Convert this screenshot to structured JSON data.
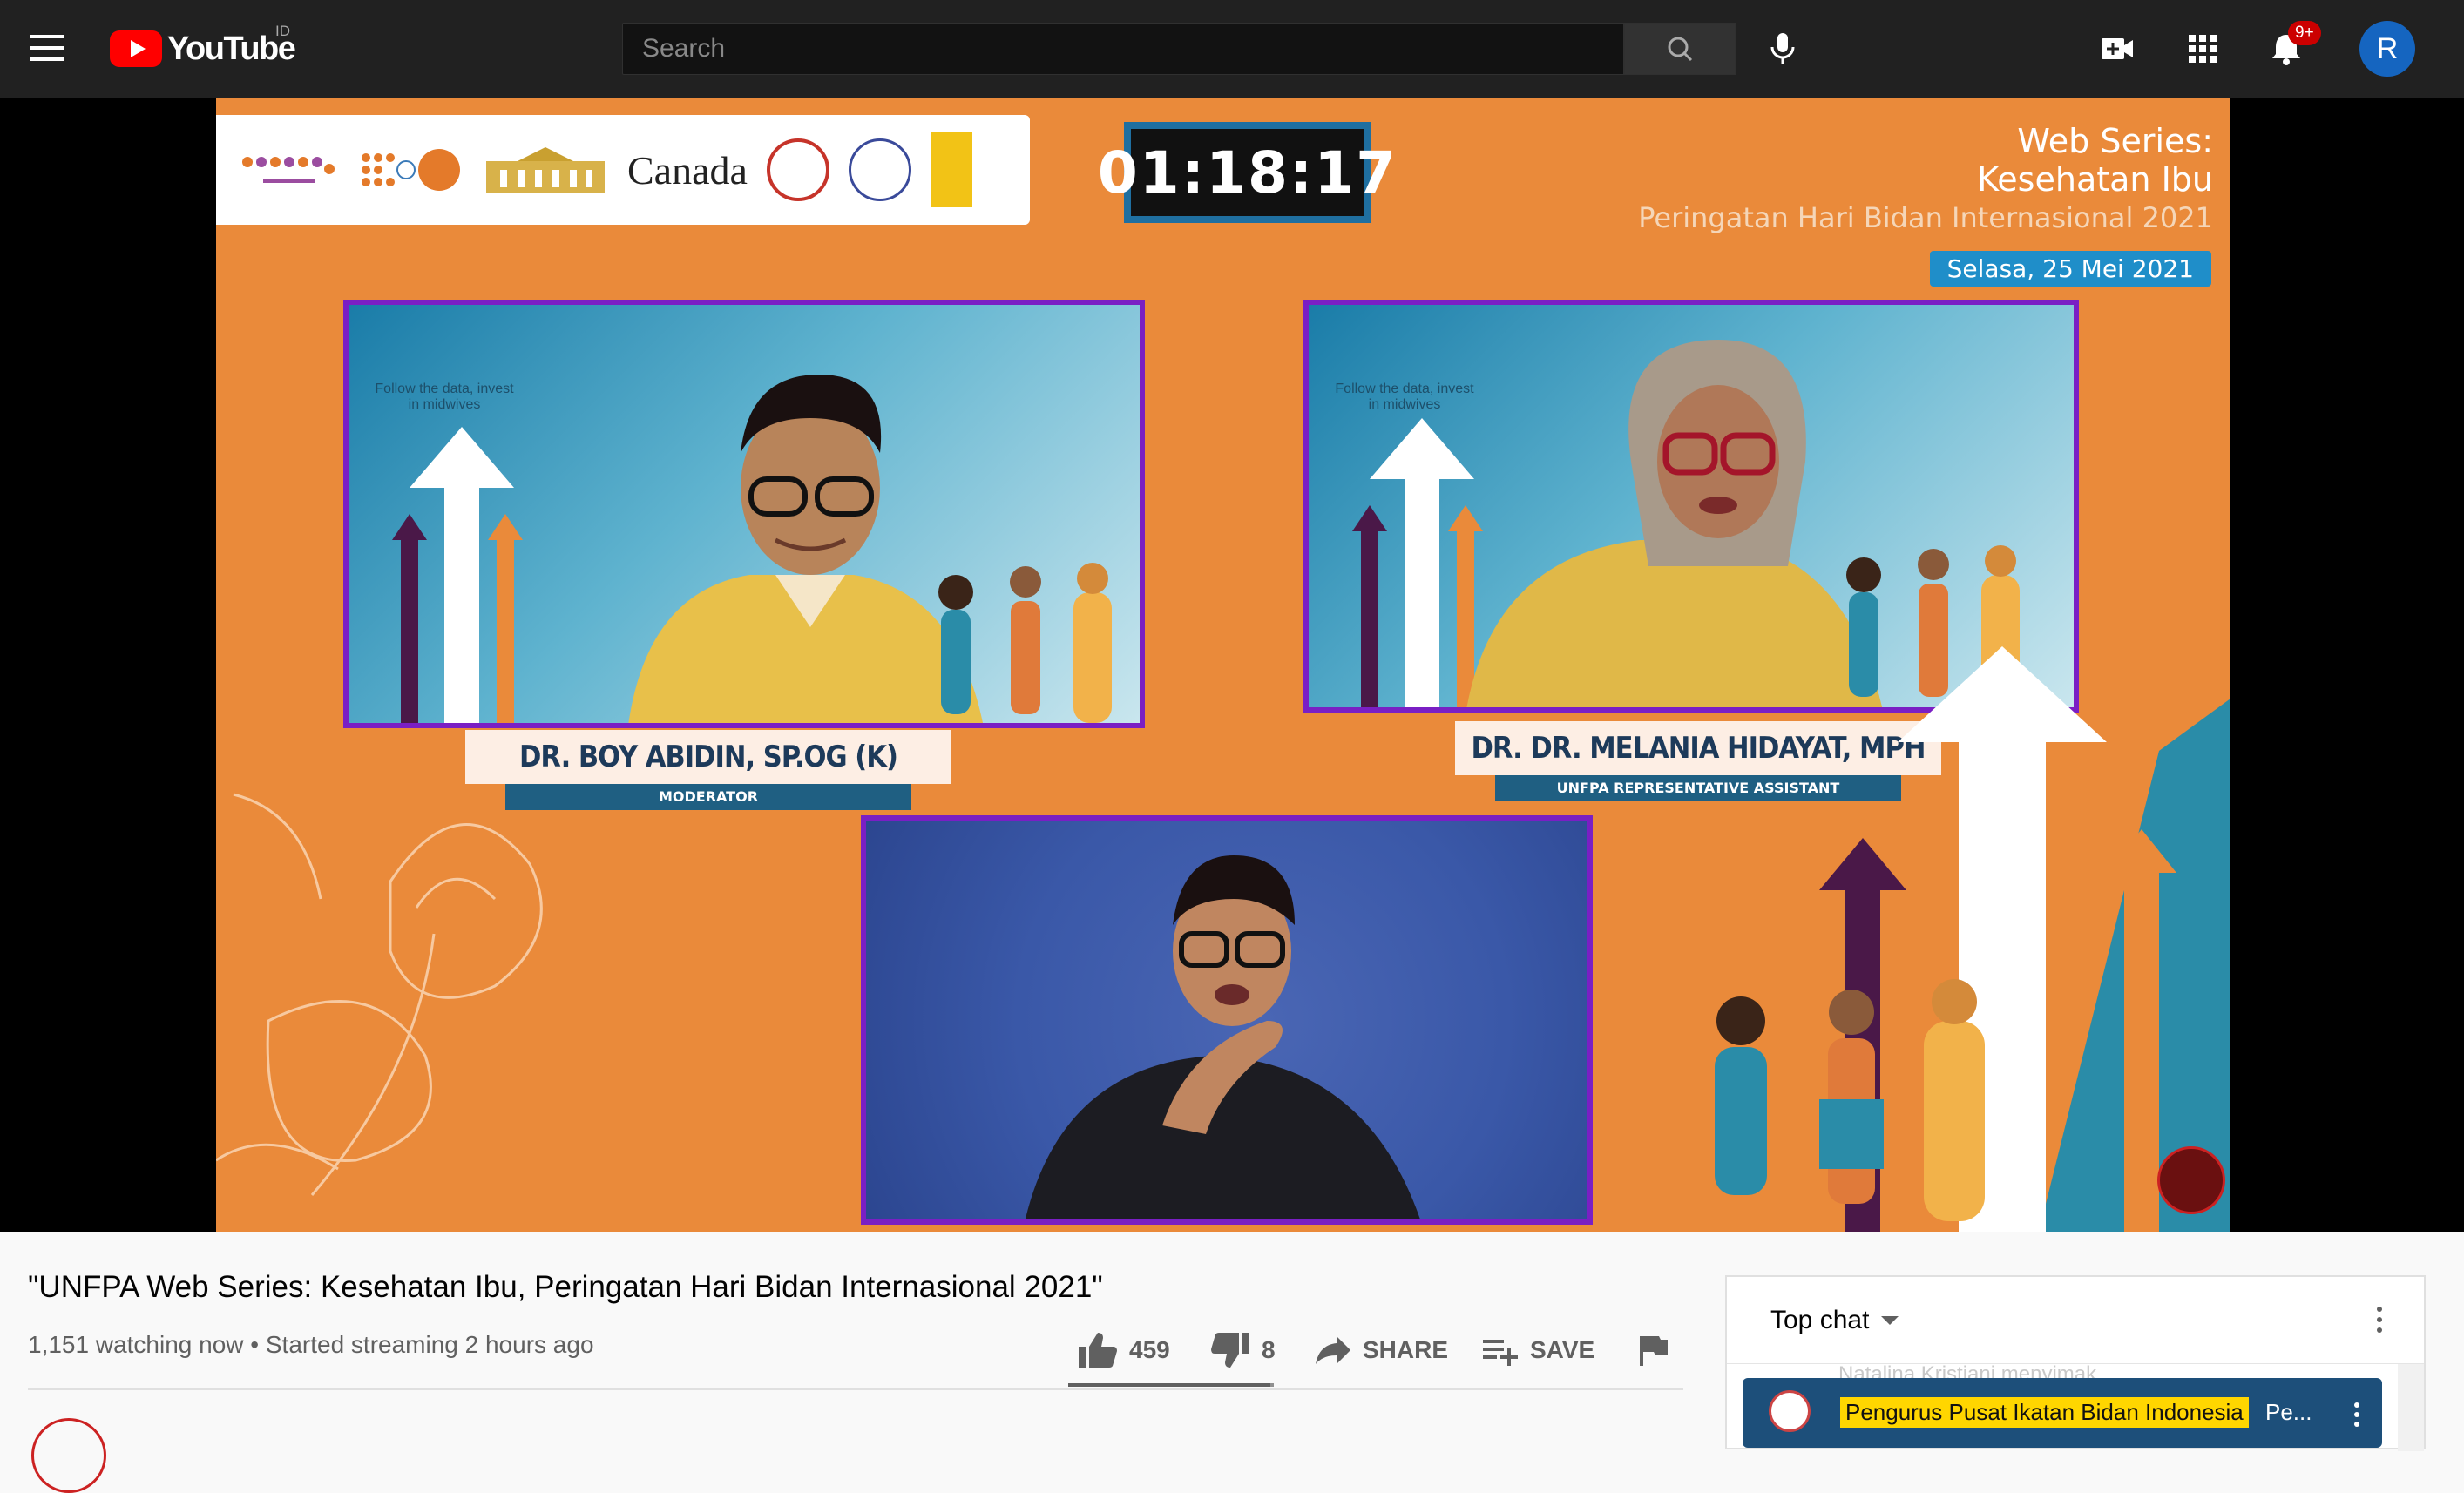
{
  "topbar": {
    "logo_text": "YouTube",
    "country_code": "ID",
    "search_placeholder": "Search",
    "notification_count": "9+",
    "avatar_letter": "R"
  },
  "video": {
    "timer": "01:18:17",
    "series_line1": "Web Series:",
    "series_line2": "Kesehatan Ibu",
    "series_line3": "Peringatan Hari Bidan Internasional 2021",
    "series_date": "Selasa, 25 Mei 2021",
    "banner_canada": "Canada",
    "panel_caption_left": "Follow the data, invest in midwives",
    "panel_caption_right": "Follow the data, invest in midwives",
    "speaker1_name": "DR. BOY ABIDIN, SP.OG (K)",
    "speaker1_role": "MODERATOR",
    "speaker2_name": "DR. DR. MELANIA HIDAYAT, MPH",
    "speaker2_role": "UNFPA REPRESENTATIVE ASSISTANT"
  },
  "info": {
    "title": "\"UNFPA Web Series: Kesehatan Ibu, Peringatan Hari Bidan Internasional 2021\"",
    "meta": "1,151 watching now • Started streaming 2 hours ago",
    "likes": "459",
    "dislikes": "8",
    "share_label": "SHARE",
    "save_label": "SAVE",
    "like_ratio": 0.983
  },
  "chat": {
    "mode_label": "Top chat",
    "faded_message": "Natalina Kristiani   menyimak",
    "pinned_author": "Pengurus Pusat Ikatan Bidan Indonesia",
    "pinned_text": "Pe..."
  },
  "colors": {
    "topbar_bg": "#212121",
    "video_bg": "#ea8a3a",
    "panel_border": "#7a1fc4",
    "brand_red": "#ff0000"
  }
}
